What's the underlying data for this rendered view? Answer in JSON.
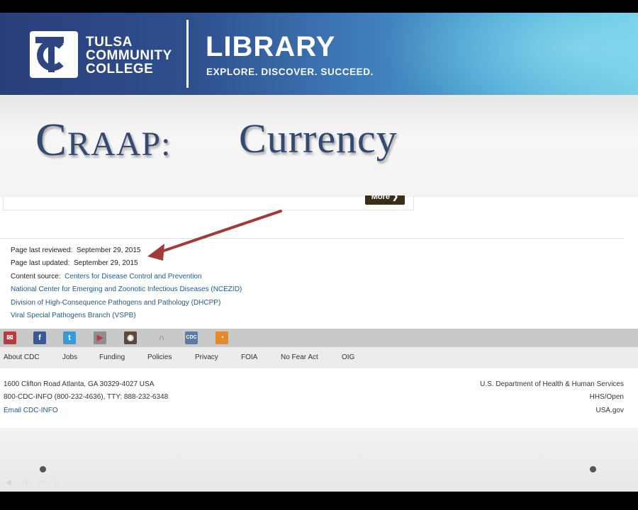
{
  "banner": {
    "college_line1": "TULSA",
    "college_line2": "COMMUNITY",
    "college_line3": "COLLEGE",
    "title": "LIBRARY",
    "tagline": "EXPLORE. DISCOVER. SUCCEED."
  },
  "slide": {
    "title_first": "C",
    "title_rest": "RAAP:",
    "title_topic": "Currency"
  },
  "content": {
    "more_button": "More ❯",
    "reviewed_label": "Page last reviewed:",
    "reviewed_date": "September 29, 2015",
    "updated_label": "Page last updated:",
    "updated_date": "September 29, 2015",
    "source_label": "Content source:",
    "source_value": "Centers for Disease Control and Prevention",
    "links": [
      "National Center for Emerging and Zoonotic Infectious Diseases (NCEZID)",
      "Division of High-Consequence Pathogens and Pathology (DHCPP)",
      "Viral Special Pathogens Branch (VSPB)"
    ],
    "arrow_color": "#a33a3a"
  },
  "social": {
    "icons": [
      "email-icon",
      "facebook-icon",
      "twitter-icon",
      "youtube-icon",
      "instagram-icon",
      "podcast-icon",
      "cdc-tv-icon",
      "rss-icon"
    ]
  },
  "footer_nav": [
    "About CDC",
    "Jobs",
    "Funding",
    "Policies",
    "Privacy",
    "FOIA",
    "No Fear Act",
    "OIG"
  ],
  "address": {
    "line1": "1600 Clifton Road Atlanta, GA 30329-4027 USA",
    "line2": "800-CDC-INFO (800-232-4636), TTY: 888-232-6348",
    "email": "Email CDC-INFO",
    "right1": "U.S. Department of Health & Human Services",
    "right2": "HHS/Open",
    "right3": "USA.gov"
  },
  "colors": {
    "banner_dark": "#2a3f7a",
    "banner_light": "#6ccbe6",
    "title_color": "#34496f",
    "link_color": "#1f5a94"
  }
}
